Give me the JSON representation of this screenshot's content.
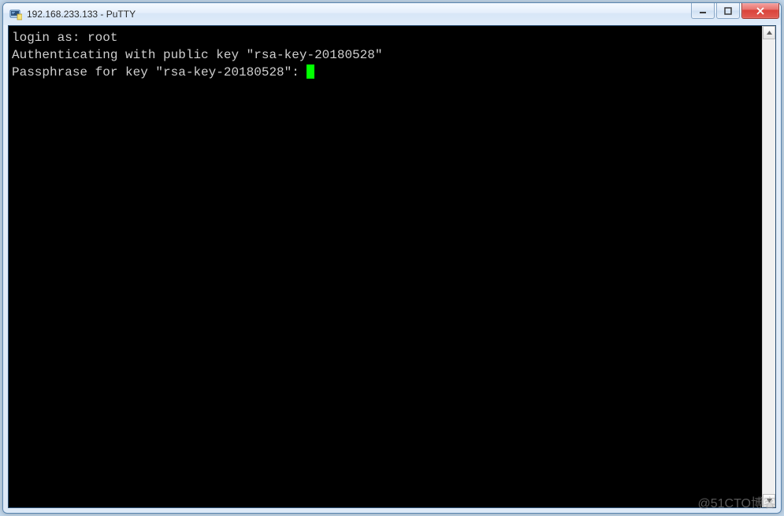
{
  "window": {
    "title": "192.168.233.133 - PuTTY"
  },
  "terminal": {
    "line1_prompt": "login as: ",
    "line1_input": "root",
    "line2": "Authenticating with public key \"rsa-key-20180528\"",
    "line3": "Passphrase for key \"rsa-key-20180528\": "
  },
  "watermark": "@51CTO博客"
}
